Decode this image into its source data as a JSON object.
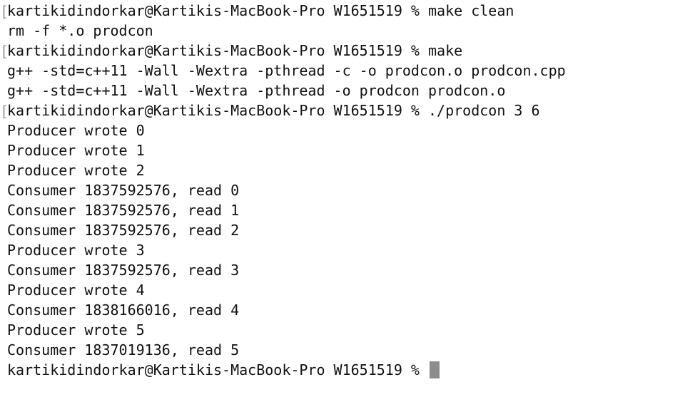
{
  "terminal": {
    "lines": [
      {
        "text": "kartikidindorkar@Kartikis-MacBook-Pro W1651519 % make clean",
        "mark": "["
      },
      {
        "text": "rm -f *.o prodcon"
      },
      {
        "text": "kartikidindorkar@Kartikis-MacBook-Pro W1651519 % make",
        "mark": "["
      },
      {
        "text": "g++ -std=c++11 -Wall -Wextra -pthread -c -o prodcon.o prodcon.cpp"
      },
      {
        "text": "g++ -std=c++11 -Wall -Wextra -pthread -o prodcon prodcon.o"
      },
      {
        "text": "kartikidindorkar@Kartikis-MacBook-Pro W1651519 % ./prodcon 3 6",
        "mark": "["
      },
      {
        "text": "Producer wrote 0"
      },
      {
        "text": "Producer wrote 1"
      },
      {
        "text": "Producer wrote 2"
      },
      {
        "text": "Consumer 1837592576, read 0"
      },
      {
        "text": "Consumer 1837592576, read 1"
      },
      {
        "text": "Consumer 1837592576, read 2"
      },
      {
        "text": "Producer wrote 3"
      },
      {
        "text": "Consumer 1837592576, read 3"
      },
      {
        "text": "Producer wrote 4"
      },
      {
        "text": "Consumer 1838166016, read 4"
      },
      {
        "text": "Producer wrote 5"
      },
      {
        "text": "Consumer 1837019136, read 5"
      }
    ],
    "prompt": "kartikidindorkar@Kartikis-MacBook-Pro W1651519 % ",
    "colors": {
      "background": "#ffffff",
      "text": "#111111",
      "cursor": "#8c8c8c"
    }
  }
}
